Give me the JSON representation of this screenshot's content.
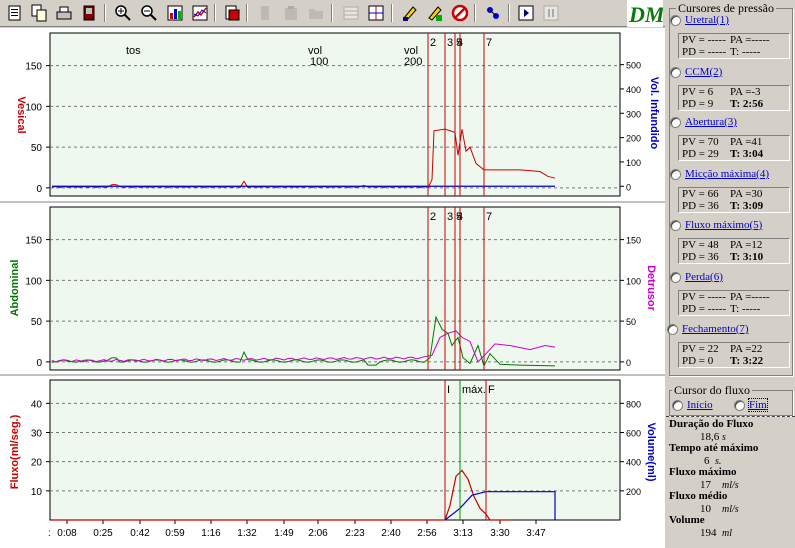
{
  "toolbar": {
    "icons": [
      "open-icon",
      "copy-icon",
      "print-icon",
      "exit-icon",
      "zoom-in-icon",
      "zoom-out-icon",
      "bar-chart-icon",
      "line-chart-icon",
      "report-icon",
      "edit-icon",
      "clipboard-icon",
      "folder-icon",
      "table-icon",
      "axes-icon",
      "marker-icon",
      "marker-edit-icon",
      "cancel-icon",
      "fit-icon",
      "play-icon",
      "pause-icon"
    ]
  },
  "colors": {
    "vesical": "#cc0000",
    "abdominal": "#007700",
    "detrusor": "#cc00cc",
    "flow": "#cc0000",
    "volume": "#0000cc",
    "grid_bg": "#eef8ee",
    "cursor_line": "#cc0000"
  },
  "plots": {
    "vesical_label": "Vesical",
    "vol_infundido_label": "Vol. Infundido",
    "abdominal_label": "Abdominal",
    "detrusor_label": "Detrusor",
    "fluxo_label": "Fluxo(ml/seg.)",
    "volume_label": "Volume(ml)",
    "annotations": {
      "tos": "tos",
      "vol100a": "vol",
      "vol100b": "100",
      "vol200a": "vol",
      "vol200b": "200"
    },
    "markers": [
      "2",
      "3",
      "4",
      "5",
      "7"
    ],
    "flow_markers": {
      "i": "I",
      "max": "máx.",
      "f": "F"
    },
    "y_left_ticks_top": [
      "150",
      "100",
      "50",
      "0"
    ],
    "y_right_ticks_top": [
      "500",
      "400",
      "300",
      "200",
      "100",
      "0"
    ],
    "y_left_ticks_mid": [
      "150",
      "100",
      "50",
      "0"
    ],
    "y_right_ticks_mid": [
      "150",
      "100",
      "50",
      "0"
    ],
    "y_left_ticks_bot": [
      "40",
      "30",
      "20",
      "10"
    ],
    "y_right_ticks_bot": [
      "800",
      "600",
      "400",
      "200"
    ],
    "x_ticks": [
      "0:08",
      "0:25",
      "0:42",
      "0:59",
      "1:16",
      "1:32",
      "1:49",
      "2:06",
      "2:23",
      "2:40",
      "2:56",
      "3:13",
      "3:30",
      "3:47"
    ]
  },
  "sidebar": {
    "cursors_title": "Cursores de pressão",
    "cursors": [
      {
        "label": "Uretral(1)",
        "pv": "PV = -----",
        "pa": "PA =-----",
        "pd": "PD = -----",
        "t": "T: -----",
        "t_bold": false
      },
      {
        "label": "CCM(2)",
        "pv": "PV = 6",
        "pa": "PA =-3",
        "pd": "PD = 9",
        "t": "T: 2:56",
        "t_bold": true
      },
      {
        "label": "Abertura(3)",
        "pv": "PV = 70",
        "pa": "PA =41",
        "pd": "PD = 29",
        "t": "T: 3:04",
        "t_bold": true
      },
      {
        "label": "Micção máxima(4)",
        "pv": "PV = 66",
        "pa": "PA =30",
        "pd": "PD = 36",
        "t": "T: 3:09",
        "t_bold": true
      },
      {
        "label": "Fluxo máximo(5)",
        "pv": "PV = 48",
        "pa": "PA =12",
        "pd": "PD = 36",
        "t": "T: 3:10",
        "t_bold": true
      },
      {
        "label": "Perda(6)",
        "pv": "PV = -----",
        "pa": "PA =-----",
        "pd": "PD = -----",
        "t": "T: -----",
        "t_bold": false
      },
      {
        "label": "Fechamento(7)",
        "pv": "PV = 22",
        "pa": "PA =22",
        "pd": "PD = 0",
        "t": "T: 3:22",
        "t_bold": true
      }
    ],
    "flow_title": "Cursor do fluxo",
    "flow_inicio": "Início",
    "flow_fim": "Fim",
    "duracao_label": "Duração do Fluxo",
    "duracao_value": "18,6",
    "duracao_unit": "s",
    "tempo_label": "Tempo até máximo",
    "tempo_value": "6",
    "tempo_unit": "s.",
    "fmax_label": "Fluxo máximo",
    "fmax_value": "17",
    "fmax_unit": "ml/s",
    "fmed_label": "Fluxo médio",
    "fmed_value": "10",
    "fmed_unit": "ml/s",
    "vol_label": "Volume",
    "vol_value": "194",
    "vol_unit": "ml"
  },
  "logo_text": "DM"
}
